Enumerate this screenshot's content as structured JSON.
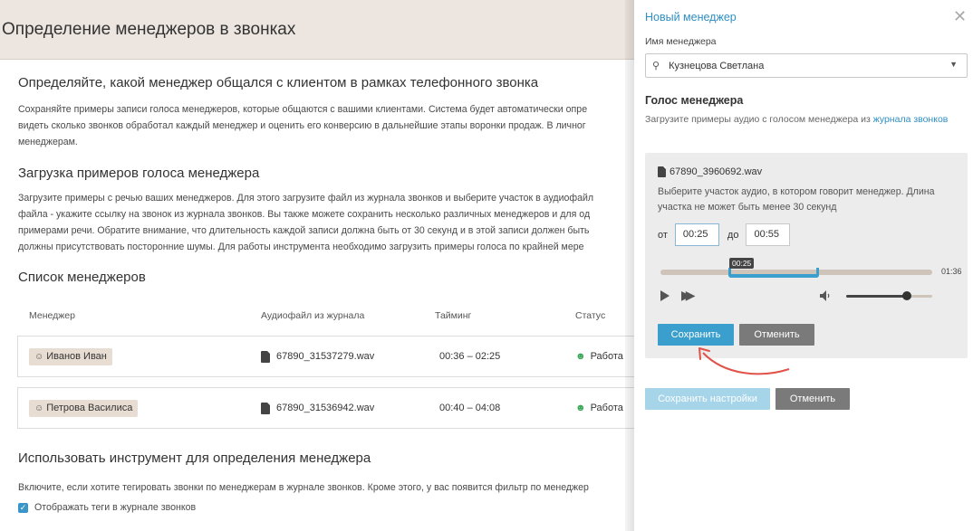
{
  "main": {
    "header_title": "Определение менеджеров в звонках",
    "section1": {
      "title": "Определяйте, какой менеджер общался с клиентом в рамках телефонного звонка",
      "lines": [
        "Сохраняйте примеры записи голоса менеджеров, которые общаются с вашими клиентами. Система будет автоматически опре",
        "видеть сколько звонков обработал каждый менеджер и оценить его конверсию в дальнейшие этапы воронки продаж. В личног",
        "менеджерам."
      ]
    },
    "section2": {
      "title": "Загрузка примеров голоса менеджера",
      "lines": [
        "Загрузите примеры с речью ваших менеджеров. Для этого загрузите файл из журнала звонков и выберите участок в аудиофайл",
        "файла - укажите ссылку на звонок из журнала звонков. Вы также можете сохранить несколько различных менеджеров и для од",
        "примерами речи. Обратите внимание, что длительность каждой записи должна быть от 30 секунд и в этой записи должен быть",
        "должны присутствовать посторонние шумы. Для работы инструмента необходимо загрузить примеры голоса по крайней мере"
      ]
    },
    "section3": {
      "title": "Список менеджеров",
      "columns": [
        "Менеджер",
        "Аудиофайл из журнала",
        "Тайминг",
        "Статус"
      ],
      "rows": [
        {
          "manager": "Иванов Иван",
          "file": "67890_31537279.wav",
          "timing": "00:36 – 02:25",
          "status": "Работа"
        },
        {
          "manager": "Петрова Василиса",
          "file": "67890_31536942.wav",
          "timing": "00:40 – 04:08",
          "status": "Работа"
        }
      ]
    },
    "section4": {
      "title": "Использовать инструмент для определения менеджера",
      "text": "Включите, если хотите тегировать звонки по менеджерам в журнале звонков. Кроме этого, у вас появится фильтр по менеджер",
      "checkbox_label": "Отображать теги в журнале звонков",
      "checkbox_checked": true
    }
  },
  "panel": {
    "title": "Новый менеджер",
    "name_label": "Имя менеджера",
    "name_value": "Кузнецова Светлана",
    "voice_title": "Голос менеджера",
    "voice_desc": "Загрузите примеры аудио с голосом менеджера из ",
    "voice_link": "журнала звонков",
    "card": {
      "filename": "67890_3960692.wav",
      "hint": "Выберите участок аудио, в котором говорит менеджер. Длина участка не может быть менее 30 секунд",
      "from_label": "от",
      "from_value": "00:25",
      "to_label": "до",
      "to_value": "00:55",
      "badge": "00:25",
      "duration": "01:36",
      "selection_start": 0.26,
      "selection_end": 0.57,
      "volume_level": 0.72,
      "save_label": "Сохранить",
      "cancel_label": "Отменить"
    },
    "save_settings_label": "Сохранить настройки",
    "cancel_label": "Отменить"
  },
  "colors": {
    "accent": "#3a9fcd",
    "header_bg": "#ede6e0",
    "tag_bg": "#e8ddd3",
    "status_ok": "#3aa757",
    "arrow": "#e0524a"
  }
}
